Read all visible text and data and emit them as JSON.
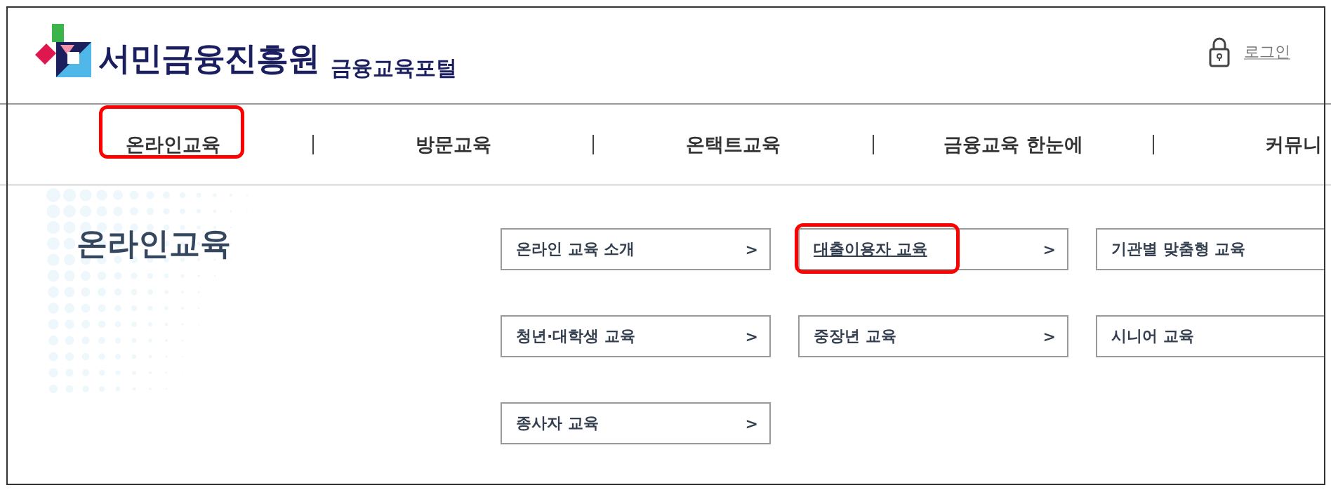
{
  "header": {
    "logo_text": "서민금융진흥원",
    "portal_name": "금융교육포털",
    "login": "로그인"
  },
  "nav": [
    {
      "label": "온라인교육",
      "highlighted": true
    },
    {
      "label": "방문교육",
      "highlighted": false
    },
    {
      "label": "온택트교육",
      "highlighted": false
    },
    {
      "label": "금융교육 한눈에",
      "highlighted": false
    },
    {
      "label": "커뮤니",
      "highlighted": false
    }
  ],
  "section_title": "온라인교육",
  "submenu": [
    {
      "label": "온라인 교육 소개",
      "arrow": ">",
      "highlighted": false
    },
    {
      "label": "대출이용자 교육",
      "arrow": ">",
      "highlighted": true
    },
    {
      "label": "기관별 맞춤형 교육",
      "highlighted": false
    },
    {
      "label": "청년·대학생 교육",
      "arrow": ">",
      "highlighted": false
    },
    {
      "label": "중장년 교육",
      "arrow": ">",
      "highlighted": false
    },
    {
      "label": "시니어 교육",
      "highlighted": false
    },
    {
      "label": "종사자 교육",
      "arrow": ">",
      "highlighted": false
    }
  ]
}
